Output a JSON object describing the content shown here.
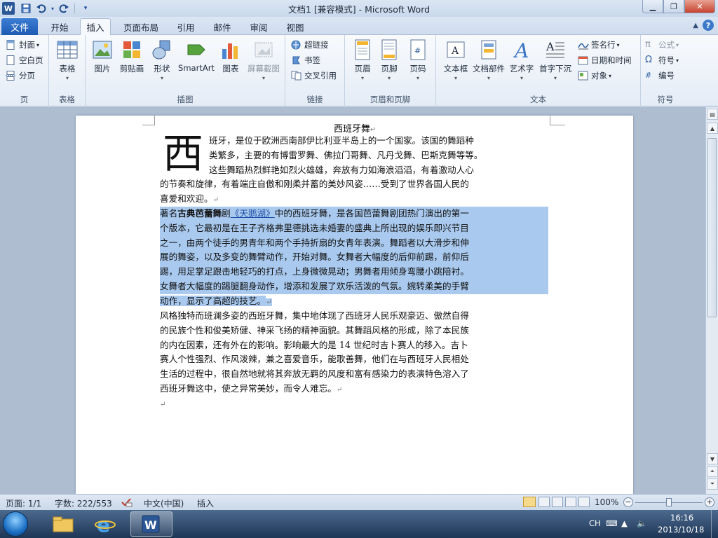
{
  "window": {
    "title": "文档1 [兼容模式] - Microsoft Word",
    "app_logo": "W"
  },
  "tabs": {
    "file": "文件",
    "items": [
      "开始",
      "插入",
      "页面布局",
      "引用",
      "邮件",
      "审阅",
      "视图"
    ],
    "active": "插入"
  },
  "ribbon": {
    "page_group": {
      "label": "页",
      "cover": "封面",
      "blank": "空白页",
      "break": "分页"
    },
    "table_group": {
      "label": "表格",
      "table": "表格"
    },
    "illustrations": {
      "label": "插图",
      "picture": "图片",
      "clipart": "剪贴画",
      "shapes": "形状",
      "smartart": "SmartArt",
      "chart": "图表",
      "screenshot": "屏幕截图"
    },
    "links": {
      "label": "链接",
      "hyperlink": "超链接",
      "bookmark": "书签",
      "crossref": "交叉引用"
    },
    "header_footer": {
      "label": "页眉和页脚",
      "header": "页眉",
      "footer": "页脚",
      "page_number": "页码"
    },
    "text_group": {
      "label": "文本",
      "textbox": "文本框",
      "quickparts": "文档部件",
      "wordart": "艺术字",
      "dropcap": "首字下沉",
      "signature": "签名行",
      "datetime": "日期和时间",
      "object": "对象"
    },
    "symbols": {
      "label": "符号",
      "equation": "公式",
      "symbol": "符号",
      "number": "编号"
    }
  },
  "document": {
    "title": "西班牙舞",
    "dropcap": "西",
    "p1": [
      "班牙，是位于欧洲西南部伊比利亚半岛上的一个国家。该国的舞蹈种",
      "类繁多，主要的有博雷罗舞、佛拉门哥舞、凡丹戈舞、巴斯克舞等等。",
      "这些舞蹈热烈鲜艳如烈火雄雄，奔放有力如海浪滔滔，有着激动人心",
      "的节奏和旋律，有着端庄自傲和刚柔并蓄的美妙风姿……受到了世界各国人民的",
      "喜爱和欢迎。"
    ],
    "p2_head_pre": "著名",
    "p2_head_bold": "古典芭蕾舞",
    "p2_head_mid": "剧",
    "p2_head_link": "《天鹅湖》",
    "p2_head_post": "中的西班牙舞，是各国芭蕾舞剧团热门演出的第一",
    "p2": [
      "个版本，它最初是在王子齐格弗里德挑选未婚妻的盛典上所出现的娱乐即兴节目",
      "之一，由两个徒手的男青年和两个手持折扇的女青年表演。舞蹈者以大滑步和伸",
      "展的舞姿，以及多变的舞臂动作，开始对舞。女舞者大幅度的后仰前踢，前仰后",
      "踢，用足掌足跟击地轻巧的打点，上身微微晃动；男舞者用倾身弯腰小跳陪衬。",
      "女舞者大幅度的踢腿翻身动作，增添和发展了欢乐活泼的气氛。婉转柔美的手臂",
      "动作，显示了高超的技艺。"
    ],
    "p3": [
      "风格独特而班澜多姿的西班牙舞，集中地体现了西班牙人民乐观豪迈、傲然自得",
      "的民族个性和俊美矫健、神采飞扬的精神面貌。其舞蹈风格的形成，除了本民族",
      "的内在因素，还有外在的影响。影响最大的是 14 世纪时吉卜赛人的移入。吉卜",
      "赛人个性强烈、作风泼辣，兼之喜爱音乐，能歌善舞，他们在与西班牙人民相处",
      "生活的过程中，很自然地就将其奔放无羁的风度和富有感染力的表演特色溶入了",
      "西班牙舞这中，使之异常美妙，而令人难忘。"
    ],
    "para_mark": "↵"
  },
  "status": {
    "page": "页面: 1/1",
    "words": "字数: 222/553",
    "language": "中文(中国)",
    "mode": "插入",
    "zoom": "100%"
  },
  "taskbar": {
    "ime": "CH",
    "time": "16:16",
    "date": "2013/10/18"
  },
  "colors": {
    "selection": "#a9c9ee",
    "file_tab": "#2b67c0",
    "ribbon_bg": "#eef3f9"
  }
}
